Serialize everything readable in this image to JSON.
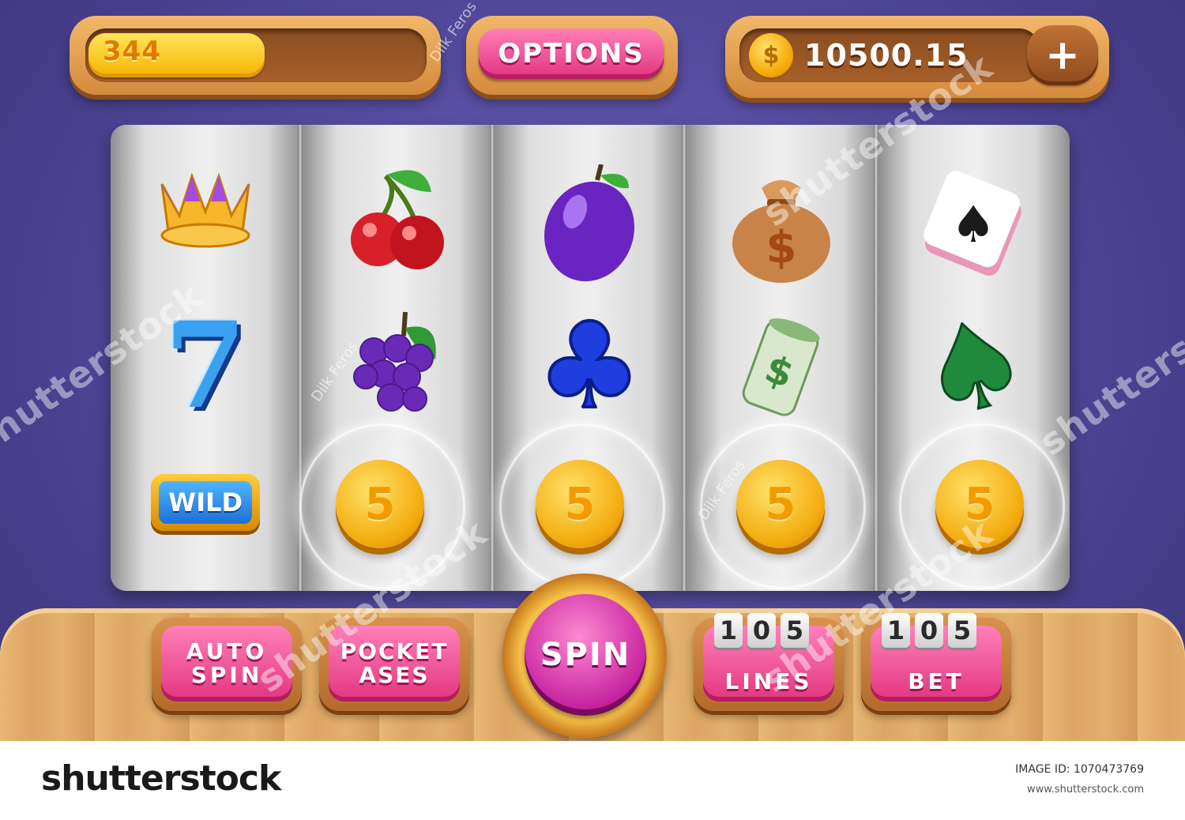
{
  "hud": {
    "level_value": "344",
    "level_progress": 0.52,
    "options_label": "OPTIONS",
    "balance_value": "10500.15",
    "coin_glyph": "$",
    "add_label": "+"
  },
  "reels": [
    [
      "crown",
      "seven",
      "wild"
    ],
    [
      "cherries",
      "grapes",
      "coin"
    ],
    [
      "plum",
      "club",
      "coin"
    ],
    [
      "money-bag",
      "cash-roll",
      "coin"
    ],
    [
      "spade-card",
      "spade",
      "coin"
    ]
  ],
  "symbols": {
    "seven_text": "7",
    "wild_text": "WILD",
    "coin_text": "5",
    "bag_text": "$",
    "cash_text": "$",
    "spade_glyph": "♠",
    "club_glyph": "♣"
  },
  "controls": {
    "auto_spin": [
      "AUTO",
      "SPIN"
    ],
    "pocket_ases": [
      "POCKET",
      "ASES"
    ],
    "spin_label": "SPIN",
    "lines": {
      "digits": [
        "1",
        "0",
        "5"
      ],
      "label": "LINES"
    },
    "bet": {
      "digits": [
        "1",
        "0",
        "5"
      ],
      "label": "BET"
    }
  },
  "watermark": {
    "brand": "shutterstock",
    "author": "Dilk Feros",
    "image_id": "IMAGE ID: 1070473769",
    "url": "www.shutterstock.com"
  },
  "colors": {
    "background": "#4e4596",
    "accent_pink": "#e2337f",
    "wood": "#d48a3c",
    "gold": "#f4ac10"
  }
}
